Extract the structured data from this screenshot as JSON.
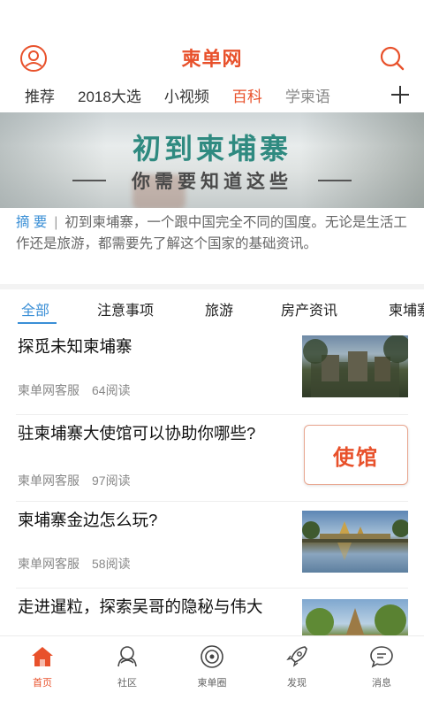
{
  "header": {
    "title": "柬单网"
  },
  "tabs": [
    {
      "label": "推荐"
    },
    {
      "label": "2018大选"
    },
    {
      "label": "小视频"
    },
    {
      "label": "百科"
    },
    {
      "label": "学柬语"
    }
  ],
  "banner": {
    "title": "初到柬埔寨",
    "subtitle": "你需要知道这些"
  },
  "summary": {
    "label": "摘 要",
    "separator": "|",
    "text": "初到柬埔寨，一个跟中国完全不同的国度。无论是生活工作还是旅游，都需要先了解这个国家的基础资讯。"
  },
  "categories": [
    {
      "label": "全部"
    },
    {
      "label": "注意事项"
    },
    {
      "label": "旅游"
    },
    {
      "label": "房产资讯"
    },
    {
      "label": "柬埔寨"
    }
  ],
  "articles": [
    {
      "title": "探觅未知柬埔寨",
      "author": "柬单网客服",
      "reads": "64阅读"
    },
    {
      "title": "驻柬埔寨大使馆可以协助你哪些?",
      "author": "柬单网客服",
      "reads": "97阅读",
      "card_text": "使馆"
    },
    {
      "title": "柬埔寨金边怎么玩?",
      "author": "柬单网客服",
      "reads": "58阅读"
    },
    {
      "title": "走进暹粒，探索吴哥的隐秘与伟大",
      "author": "",
      "reads": ""
    }
  ],
  "bottom_nav": [
    {
      "label": "首页",
      "icon": "home-icon"
    },
    {
      "label": "社区",
      "icon": "community-icon"
    },
    {
      "label": "柬单圈",
      "icon": "circle-icon"
    },
    {
      "label": "发现",
      "icon": "rocket-icon"
    },
    {
      "label": "消息",
      "icon": "message-icon"
    }
  ],
  "colors": {
    "accent": "#e8512b",
    "link": "#3a8fd6",
    "banner_title": "#2f8a80"
  }
}
